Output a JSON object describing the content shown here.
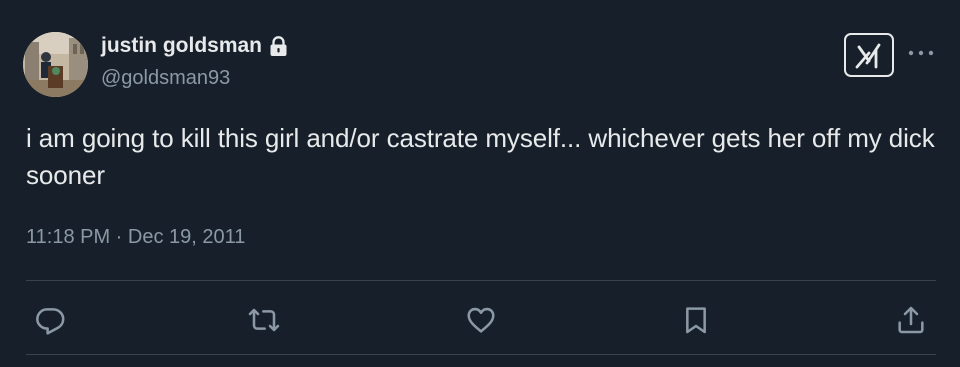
{
  "author": {
    "display_name": "justin goldsman",
    "handle": "@goldsman93",
    "protected": true
  },
  "tweet": {
    "text": "i am going to kill this girl and/or castrate myself... whichever gets her off my dick sooner",
    "timestamp": "11:18 PM · Dec 19, 2011"
  },
  "header_buttons": {
    "grok_icon": "grok-logo-icon",
    "more_icon": "more-horizontal-icon"
  },
  "actions": [
    {
      "name": "reply",
      "icon": "reply-icon"
    },
    {
      "name": "repost",
      "icon": "repost-icon"
    },
    {
      "name": "like",
      "icon": "heart-icon"
    },
    {
      "name": "bookmark",
      "icon": "bookmark-icon"
    },
    {
      "name": "share",
      "icon": "share-icon"
    }
  ],
  "colors": {
    "background": "#17202a",
    "primary_text": "#e7e9ea",
    "secondary_text": "#8b98a5",
    "icon": "#8b98a5",
    "divider": "#38444d"
  }
}
